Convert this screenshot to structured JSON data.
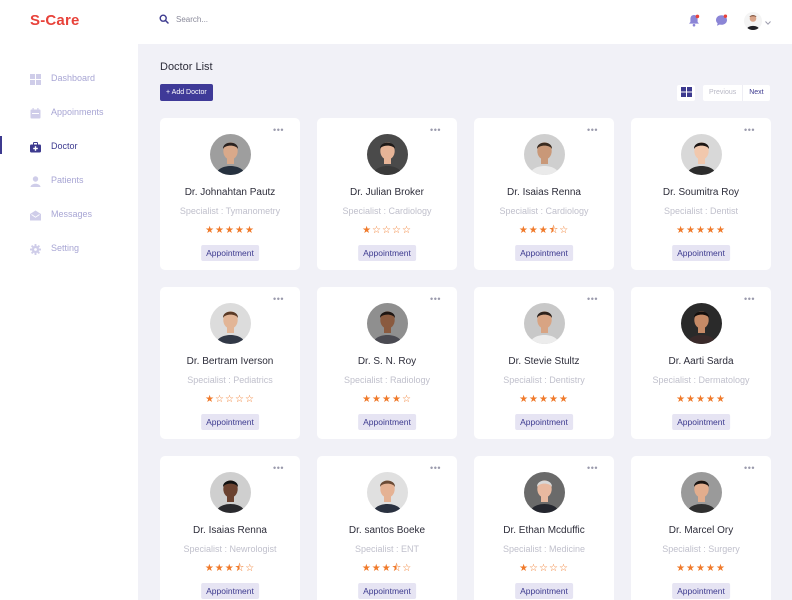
{
  "app": {
    "logo": "S-Care"
  },
  "header": {
    "search_placeholder": "Search...",
    "search_value": ""
  },
  "sidebar": {
    "items": [
      {
        "label": "Dashboard",
        "icon": "dashboard-icon",
        "active": false
      },
      {
        "label": "Appoinments",
        "icon": "calendar-icon",
        "active": false
      },
      {
        "label": "Doctor",
        "icon": "medical-bag-icon",
        "active": true
      },
      {
        "label": "Patients",
        "icon": "person-icon",
        "active": false
      },
      {
        "label": "Messages",
        "icon": "inbox-icon",
        "active": false
      },
      {
        "label": "Setting",
        "icon": "gear-icon",
        "active": false
      }
    ]
  },
  "main": {
    "title": "Doctor List",
    "add_button": "+ Add Doctor",
    "pager": {
      "previous": "Previous",
      "next": "Next"
    }
  },
  "colors": {
    "accent": "#3f3a98",
    "logo": "#e8423a",
    "star": "#f07a2b",
    "sidebar_text": "#a8a6d4",
    "appointment_bg": "#e6e4f3"
  },
  "doctors": [
    {
      "name": "Dr. Johnahtan Pautz",
      "specialty": "Specialist : Tymanometry",
      "rating": 5,
      "button": "Appointment",
      "avatar": {
        "skin": "#d9a98a",
        "hair": "#2a2220",
        "shirt": "#26313f",
        "bg": "#9e9e9e"
      }
    },
    {
      "name": "Dr. Julian Broker",
      "specialty": "Specialist : Cardiology",
      "rating": 1,
      "button": "Appointment",
      "avatar": {
        "skin": "#e6b497",
        "hair": "#1f1a18",
        "shirt": "#3a3a3a",
        "bg": "#4a4a4a"
      }
    },
    {
      "name": "Dr. Isaias Renna",
      "specialty": "Specialist : Cardiology",
      "rating": 3.5,
      "button": "Appointment",
      "avatar": {
        "skin": "#c99878",
        "hair": "#3a2b20",
        "shirt": "#eaeaea",
        "bg": "#cfcfcf"
      }
    },
    {
      "name": "Dr. Soumitra Roy",
      "specialty": "Specialist : Dentist",
      "rating": 5,
      "button": "Appointment",
      "avatar": {
        "skin": "#f1c8ad",
        "hair": "#1b1513",
        "shirt": "#2c2c2c",
        "bg": "#d8d8d8"
      }
    },
    {
      "name": "Dr. Bertram Iverson",
      "specialty": "Specialist : Pediatrics",
      "rating": 1,
      "button": "Appointment",
      "avatar": {
        "skin": "#e2b596",
        "hair": "#5a3a26",
        "shirt": "#313846",
        "bg": "#dcdcdc"
      }
    },
    {
      "name": "Dr. S. N. Roy",
      "specialty": "Specialist : Radiology",
      "rating": 4,
      "button": "Appointment",
      "avatar": {
        "skin": "#8a5a3f",
        "hair": "#1d1512",
        "shirt": "#4a4a52",
        "bg": "#8f8f8f"
      }
    },
    {
      "name": "Dr. Stevie Stultz",
      "specialty": "Specialist : Dentistry",
      "rating": 5,
      "button": "Appointment",
      "avatar": {
        "skin": "#d8a483",
        "hair": "#2d221c",
        "shirt": "#ececec",
        "bg": "#c8c8c8"
      }
    },
    {
      "name": "Dr. Aarti Sarda",
      "specialty": "Specialist : Dermatology",
      "rating": 5,
      "button": "Appointment",
      "avatar": {
        "skin": "#c68a66",
        "hair": "#140f0d",
        "shirt": "#3a2a2a",
        "bg": "#2a2a2a"
      }
    },
    {
      "name": "Dr. Isaias Renna",
      "specialty": "Specialist : Newrologist",
      "rating": 3.5,
      "button": "Appointment",
      "avatar": {
        "skin": "#6b4230",
        "hair": "#111",
        "shirt": "#2a2a2e",
        "bg": "#cfcfcf"
      }
    },
    {
      "name": "Dr. santos Boeke",
      "specialty": "Specialist : ENT",
      "rating": 3.5,
      "button": "Appointment",
      "avatar": {
        "skin": "#e5b294",
        "hair": "#6a4a35",
        "shirt": "#2a3140",
        "bg": "#e0e0e0"
      }
    },
    {
      "name": "Dr. Ethan Mcduffic",
      "specialty": "Specialist : Medicine",
      "rating": 1,
      "button": "Appointment",
      "avatar": {
        "skin": "#e8b9a0",
        "hair": "#d8d8d8",
        "shirt": "#24262e",
        "bg": "#6a6a6a"
      }
    },
    {
      "name": "Dr. Marcel Ory",
      "specialty": "Specialist : Surgery",
      "rating": 5,
      "button": "Appointment",
      "avatar": {
        "skin": "#e2ad8d",
        "hair": "#1a1412",
        "shirt": "#2f2f2f",
        "bg": "#9a9a9a"
      }
    }
  ]
}
